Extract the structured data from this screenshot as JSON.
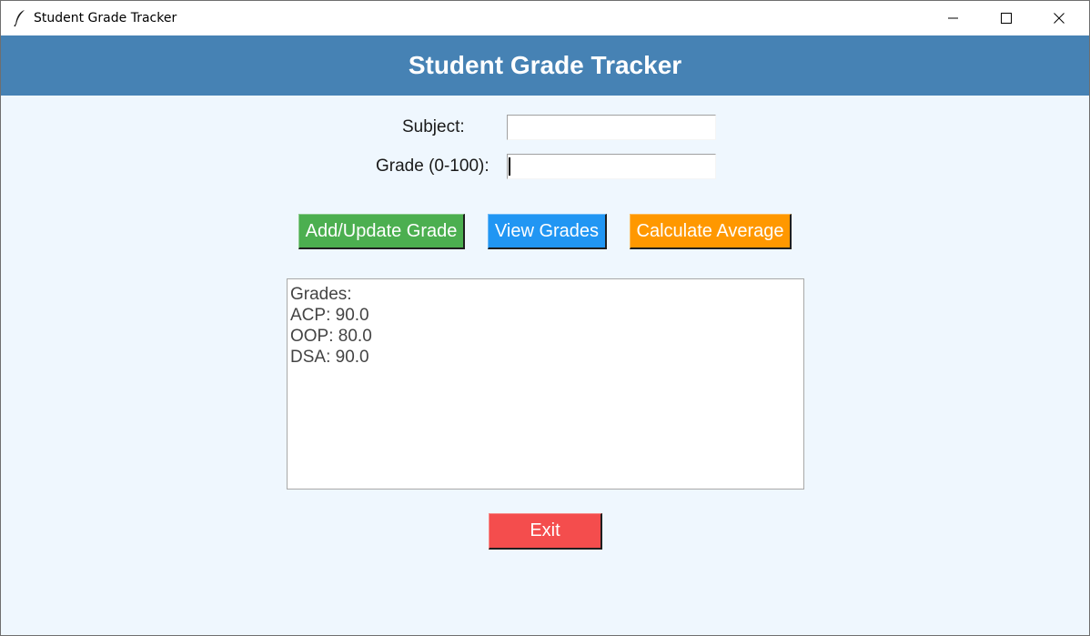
{
  "window": {
    "title": "Student Grade Tracker",
    "app_icon": "feather-icon",
    "controls": {
      "minimize_icon": "minimize-icon",
      "maximize_icon": "maximize-icon",
      "close_icon": "close-icon"
    }
  },
  "header": {
    "title": "Student Grade Tracker",
    "background": "#4682b4"
  },
  "form": {
    "subject_label": "Subject:",
    "subject_value": "",
    "grade_label": "Grade (0-100):",
    "grade_value": ""
  },
  "buttons": {
    "add_update": {
      "label": "Add/Update Grade",
      "color": "#4caf50"
    },
    "view": {
      "label": "View Grades",
      "color": "#2196f3"
    },
    "average": {
      "label": "Calculate Average",
      "color": "#ff9800"
    },
    "exit": {
      "label": "Exit",
      "color": "#f44d4d"
    }
  },
  "output": {
    "lines": [
      "Grades:",
      "ACP: 90.0",
      "OOP: 80.0",
      "DSA: 90.0"
    ]
  },
  "colors": {
    "window_bg": "#eff7fe"
  }
}
